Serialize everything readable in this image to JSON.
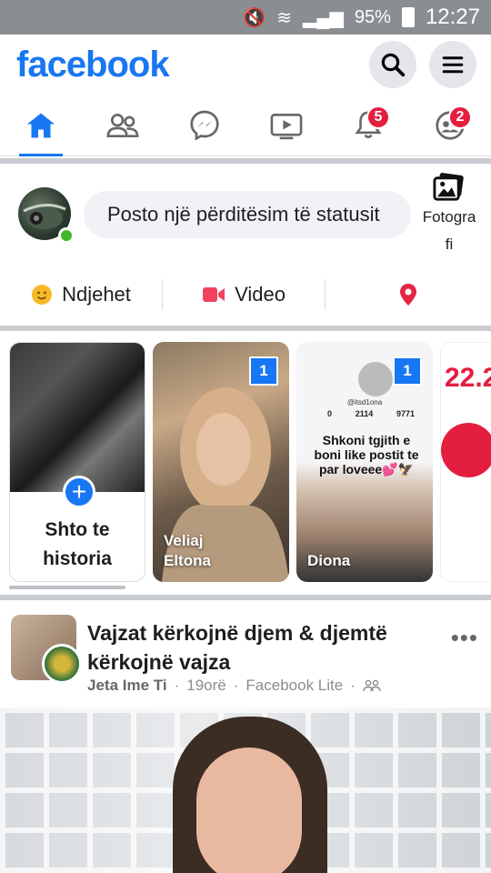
{
  "status_bar": {
    "battery": "95%",
    "time": "12:27"
  },
  "header": {
    "logo": "facebook",
    "search_icon": "search-icon",
    "menu_icon": "menu-icon"
  },
  "nav": {
    "items": [
      {
        "name": "home",
        "icon": "home-icon",
        "active": true
      },
      {
        "name": "friends",
        "icon": "friends-icon"
      },
      {
        "name": "messenger",
        "icon": "messenger-icon"
      },
      {
        "name": "watch",
        "icon": "video-icon"
      },
      {
        "name": "notifications",
        "icon": "bell-icon",
        "badge": "5"
      },
      {
        "name": "groups",
        "icon": "groups-icon",
        "badge": "2"
      }
    ]
  },
  "composer": {
    "placeholder": "Posto një përditësim të statusit",
    "photo_label_1": "Fotogra",
    "photo_label_2": "fi",
    "actions": [
      {
        "label": "Ndjehet",
        "icon": "smiley-icon",
        "color": "#f7b928"
      },
      {
        "label": "Video",
        "icon": "video-camera-icon",
        "color": "#f3425f"
      },
      {
        "label": "",
        "icon": "location-pin-icon",
        "color": "#e42645"
      }
    ]
  },
  "stories": {
    "create_label_1": "Shto te",
    "create_label_2": "historia",
    "items": [
      {
        "count": "1",
        "name_1": "Veliaj",
        "name_2": "Eltona"
      },
      {
        "count": "1",
        "name_1": "Diona",
        "tiktok_handle": "@itsd1ona",
        "tiktok_stats": [
          "0",
          "2114",
          "9771"
        ],
        "tiktok_text": "Shkoni tgjith e boni like postit te par loveee💕🦅"
      },
      {
        "partial_text": "22.2"
      }
    ]
  },
  "post": {
    "title": "Vajzat kërkojnë djem & djemtë kërkojnë vajza",
    "group": "Jeta Ime Ti",
    "time": "19orë",
    "source": "Facebook Lite"
  },
  "colors": {
    "brand": "#1877f2",
    "badge": "#e41e3f",
    "online": "#42b72a"
  }
}
